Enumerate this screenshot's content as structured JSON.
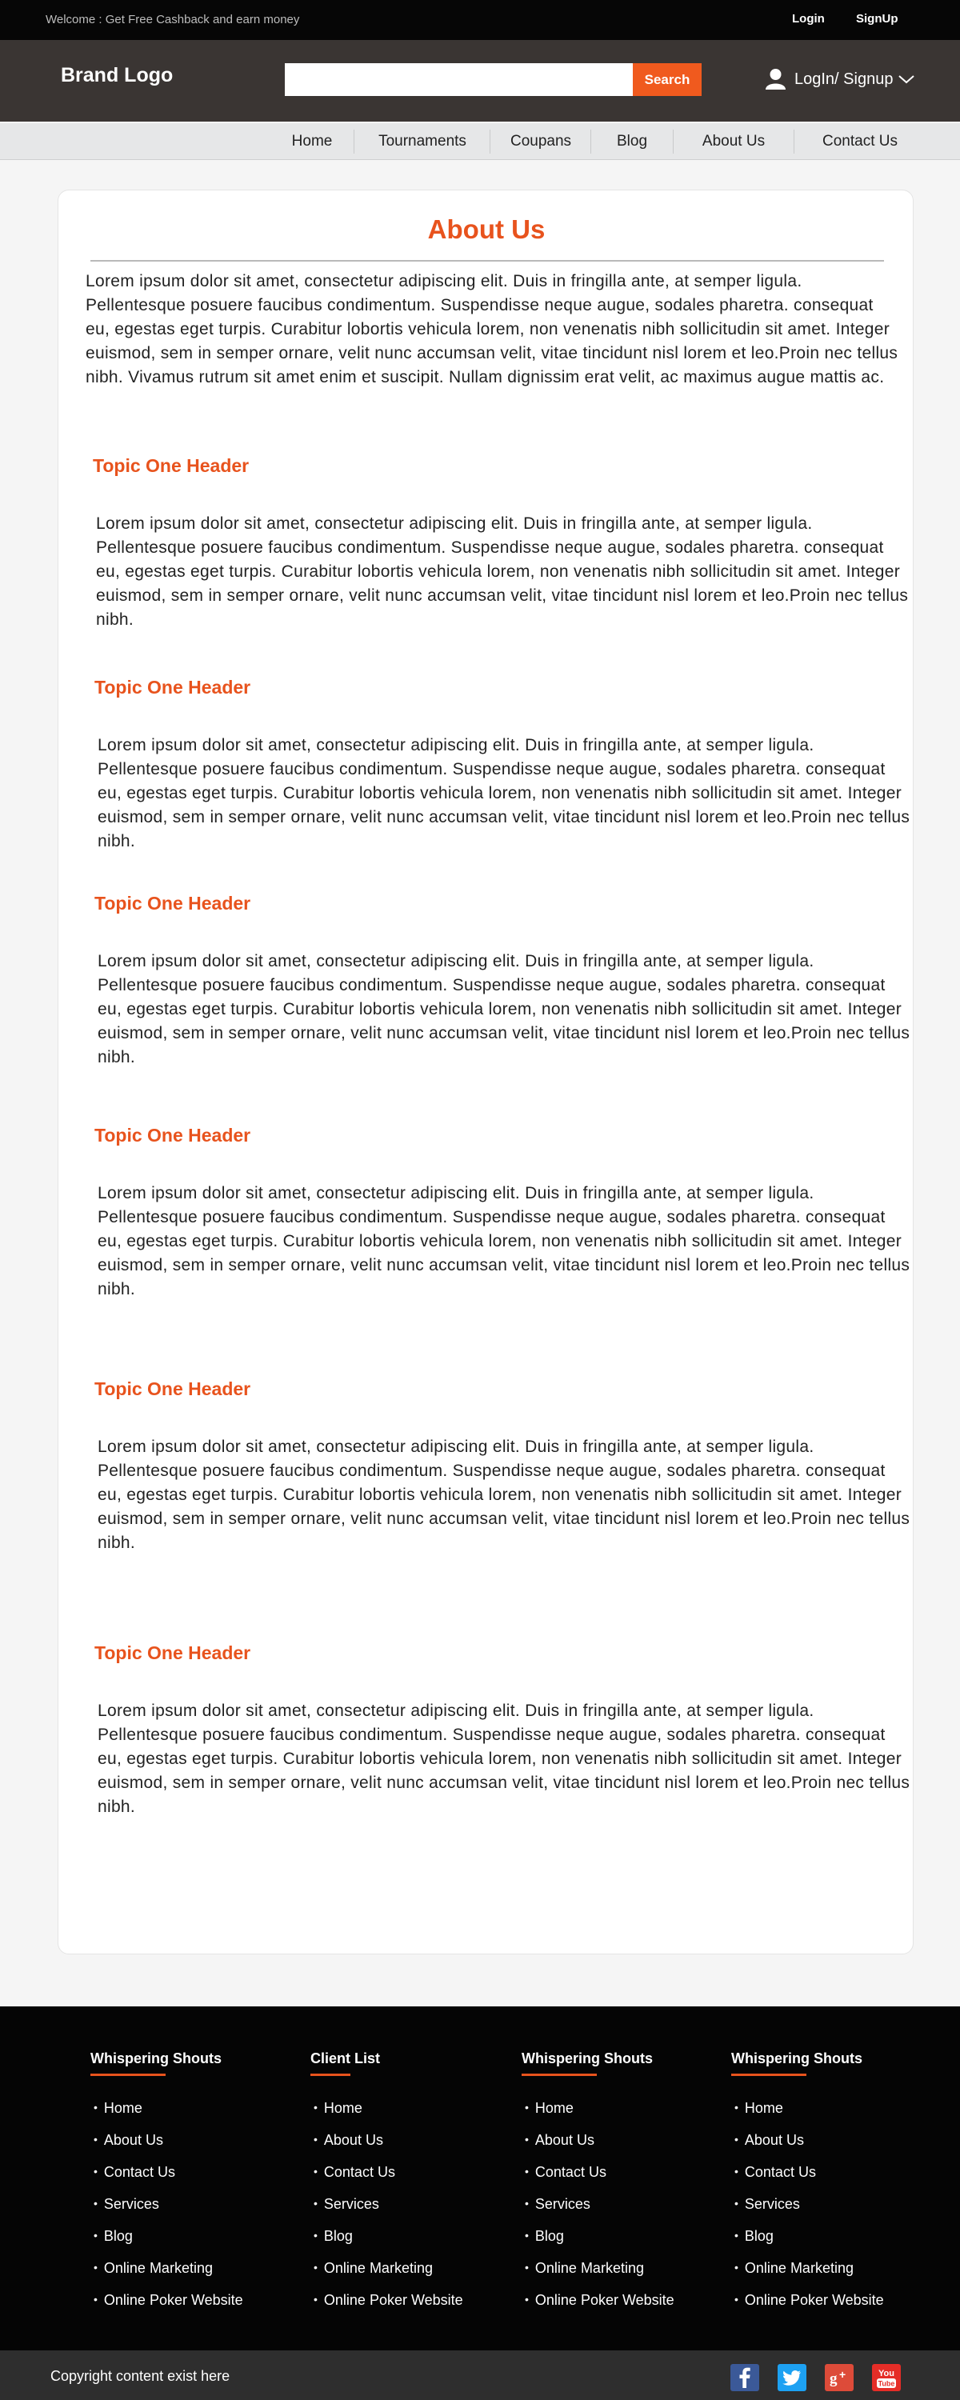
{
  "topbar": {
    "welcome": "Welcome : Get Free Cashback and earn money",
    "login": "Login",
    "signup": "SignUp"
  },
  "header": {
    "brand": "Brand Logo",
    "search_placeholder": "",
    "search_button": "Search",
    "login_signup": "LogIn/ Signup"
  },
  "nav": {
    "items": [
      "Home",
      "Tournaments",
      "Coupans",
      "Blog",
      "About Us",
      "Contact Us"
    ]
  },
  "main": {
    "title": "About Us",
    "intro": "Lorem ipsum dolor sit amet, consectetur adipiscing elit. Duis in fringilla ante, at semper ligula. Pellentesque posuere faucibus condimentum. Suspendisse neque augue, sodales pharetra. consequat eu, egestas eget turpis. Curabitur lobortis vehicula lorem, non venenatis nibh sollicitudin sit amet. Integer euismod, sem in semper ornare, velit nunc accumsan velit, vitae tincidunt nisl lorem et leo.Proin nec tellus nibh. Vivamus rutrum sit amet enim et suscipit. Nullam dignissim erat velit, ac maximus augue mattis ac.",
    "topics": [
      {
        "header": "Topic One Header",
        "body": "Lorem ipsum dolor sit amet, consectetur adipiscing elit. Duis in fringilla ante, at semper ligula. Pellentesque posuere faucibus condimentum. Suspendisse neque augue, sodales pharetra. consequat eu, egestas eget turpis. Curabitur lobortis vehicula lorem, non venenatis nibh sollicitudin sit amet. Integer euismod, sem in semper ornare, velit nunc accumsan velit, vitae tincidunt nisl lorem et leo.Proin nec tellus nibh."
      },
      {
        "header": "Topic One Header",
        "body": "Lorem ipsum dolor sit amet, consectetur adipiscing elit. Duis in fringilla ante, at semper ligula. Pellentesque posuere faucibus condimentum. Suspendisse neque augue, sodales pharetra. consequat eu, egestas eget turpis. Curabitur lobortis vehicula lorem, non venenatis nibh sollicitudin sit amet. Integer euismod, sem in semper ornare, velit nunc accumsan velit, vitae tincidunt nisl lorem et leo.Proin nec tellus nibh."
      },
      {
        "header": "Topic One Header",
        "body": "Lorem ipsum dolor sit amet, consectetur adipiscing elit. Duis in fringilla ante, at semper ligula. Pellentesque posuere faucibus condimentum. Suspendisse neque augue, sodales pharetra. consequat eu, egestas eget turpis. Curabitur lobortis vehicula lorem, non venenatis nibh sollicitudin sit amet. Integer euismod, sem in semper ornare, velit nunc accumsan velit, vitae tincidunt nisl lorem et leo.Proin nec tellus nibh."
      },
      {
        "header": "Topic One Header",
        "body": "Lorem ipsum dolor sit amet, consectetur adipiscing elit. Duis in fringilla ante, at semper ligula. Pellentesque posuere faucibus condimentum. Suspendisse neque augue, sodales pharetra. consequat eu, egestas eget turpis. Curabitur lobortis vehicula lorem, non venenatis nibh sollicitudin sit amet. Integer euismod, sem in semper ornare, velit nunc accumsan velit, vitae tincidunt nisl lorem et leo.Proin nec tellus nibh."
      },
      {
        "header": "Topic One Header",
        "body": "Lorem ipsum dolor sit amet, consectetur adipiscing elit. Duis in fringilla ante, at semper ligula. Pellentesque posuere faucibus condimentum. Suspendisse neque augue, sodales pharetra. consequat eu, egestas eget turpis. Curabitur lobortis vehicula lorem, non venenatis nibh sollicitudin sit amet. Integer euismod, sem in semper ornare, velit nunc accumsan velit, vitae tincidunt nisl lorem et leo.Proin nec tellus nibh."
      },
      {
        "header": "Topic One Header",
        "body": "Lorem ipsum dolor sit amet, consectetur adipiscing elit. Duis in fringilla ante, at semper ligula. Pellentesque posuere faucibus condimentum. Suspendisse neque augue, sodales pharetra. consequat eu, egestas eget turpis. Curabitur lobortis vehicula lorem, non venenatis nibh sollicitudin sit amet. Integer euismod, sem in semper ornare, velit nunc accumsan velit, vitae tincidunt nisl lorem et leo.Proin nec tellus nibh."
      }
    ]
  },
  "footer": {
    "columns": [
      {
        "title": "Whispering Shouts",
        "links": [
          "Home",
          "About Us",
          "Contact Us",
          "Services",
          "Blog",
          "Online Marketing",
          "Online Poker Website"
        ]
      },
      {
        "title": "Client List",
        "links": [
          "Home",
          "About Us",
          "Contact Us",
          "Services",
          "Blog",
          "Online Marketing",
          "Online Poker Website"
        ]
      },
      {
        "title": "Whispering Shouts",
        "links": [
          "Home",
          "About Us",
          "Contact Us",
          "Services",
          "Blog",
          "Online Marketing",
          "Online Poker Website"
        ]
      },
      {
        "title": "Whispering Shouts",
        "links": [
          "Home",
          "About Us",
          "Contact Us",
          "Services",
          "Blog",
          "Online Marketing",
          "Online Poker Website"
        ]
      }
    ],
    "copyright": "Copyright content exist here",
    "social": [
      {
        "name": "facebook-icon",
        "glyph": "f",
        "color": "#3b5998"
      },
      {
        "name": "twitter-icon",
        "glyph": "t",
        "color": "#1da1f2"
      },
      {
        "name": "google-plus-icon",
        "glyph": "g+",
        "color": "#dd4b39"
      },
      {
        "name": "youtube-icon",
        "glyph": "You Tube",
        "color": "#e52d27"
      }
    ]
  },
  "colors": {
    "accent": "#e8531d",
    "search_button": "#f05a1e",
    "header_bg": "#3a3533",
    "topbar_bg": "#060606",
    "footer_bg": "#050505"
  }
}
